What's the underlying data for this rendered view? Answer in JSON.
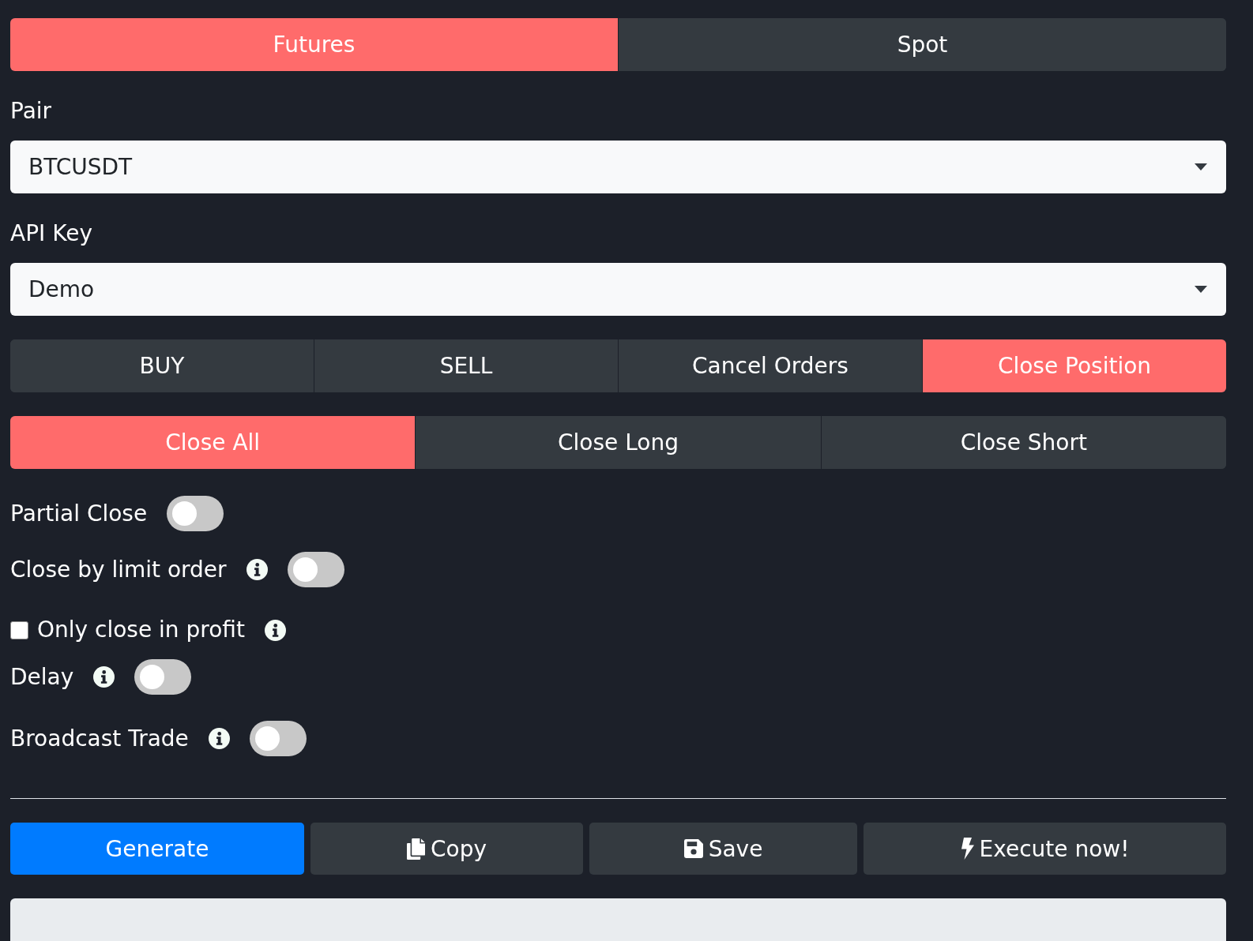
{
  "market_tabs": [
    {
      "label": "Futures",
      "selected": true
    },
    {
      "label": "Spot",
      "selected": false
    }
  ],
  "fields": [
    {
      "label": "Pair",
      "value": "BTCUSDT"
    },
    {
      "label": "API Key",
      "value": "Demo"
    }
  ],
  "action_tabs": [
    {
      "label": "BUY",
      "selected": false
    },
    {
      "label": "SELL",
      "selected": false
    },
    {
      "label": "Cancel Orders",
      "selected": false
    },
    {
      "label": "Close Position",
      "selected": true
    }
  ],
  "close_tabs": [
    {
      "label": "Close All",
      "selected": true
    },
    {
      "label": "Close Long",
      "selected": false
    },
    {
      "label": "Close Short",
      "selected": false
    }
  ],
  "options": [
    {
      "kind": "toggle",
      "label": "Partial Close",
      "on": false
    },
    {
      "kind": "toggle",
      "label": "Close by limit order",
      "on": false,
      "info": true
    },
    {
      "kind": "checkbox",
      "label": "Only close in profit",
      "checked": false,
      "info": true
    },
    {
      "kind": "toggle",
      "label": "Delay",
      "on": false,
      "info": true
    },
    {
      "kind": "toggle",
      "label": "Broadcast Trade",
      "on": false,
      "info": true
    }
  ],
  "buttons": [
    {
      "kind": "generate",
      "label": "Generate"
    },
    {
      "kind": "copy",
      "label": "Copy"
    },
    {
      "kind": "save",
      "label": "Save"
    },
    {
      "kind": "execute",
      "label": "Execute now!"
    }
  ]
}
